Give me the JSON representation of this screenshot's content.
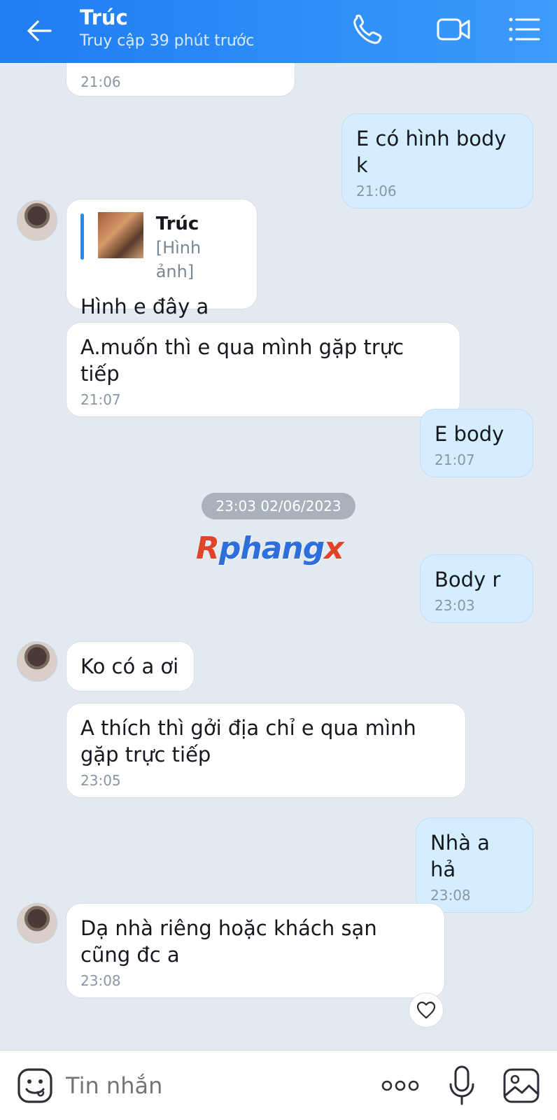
{
  "header": {
    "title": "Trúc",
    "subtitle": "Truy cập 39 phút trước",
    "accent": "#2188f4"
  },
  "watermark": {
    "text_r": "R",
    "text_mid": "phang",
    "text_x": "x"
  },
  "date_separator": "23:03 02/06/2023",
  "messages": [
    {
      "side": "other",
      "text": "",
      "time": "21:06"
    },
    {
      "side": "me",
      "text": "E có hình body k",
      "time": "21:06"
    },
    {
      "side": "other",
      "reply_name": "Trúc",
      "reply_type": "[Hình ảnh]",
      "text": "Hình e đây a",
      "time": ""
    },
    {
      "side": "other",
      "text": "A.muốn thì e qua mình gặp trực tiếp",
      "time": "21:07"
    },
    {
      "side": "me",
      "text": "E body",
      "time": "21:07"
    },
    {
      "side": "me",
      "text": "Body r",
      "time": "23:03"
    },
    {
      "side": "other",
      "text": "Ko có a ơi",
      "time": ""
    },
    {
      "side": "other",
      "text": "A thích thì gởi địa chỉ e qua mình gặp trực tiếp",
      "time": "23:05"
    },
    {
      "side": "me",
      "text": "Nhà a hả",
      "time": "23:08"
    },
    {
      "side": "other",
      "text": "Dạ nhà riêng hoặc khách sạn cũng đc a",
      "time": "23:08"
    }
  ],
  "input": {
    "placeholder": "Tin nhắn"
  },
  "icons": {
    "back": "arrow-left-icon",
    "call": "phone-icon",
    "video": "video-camera-icon",
    "menu": "list-menu-icon",
    "emoji": "sticker-emoji-icon",
    "more": "more-dots-icon",
    "mic": "microphone-icon",
    "image": "image-gallery-icon",
    "reaction": "heart-icon"
  }
}
